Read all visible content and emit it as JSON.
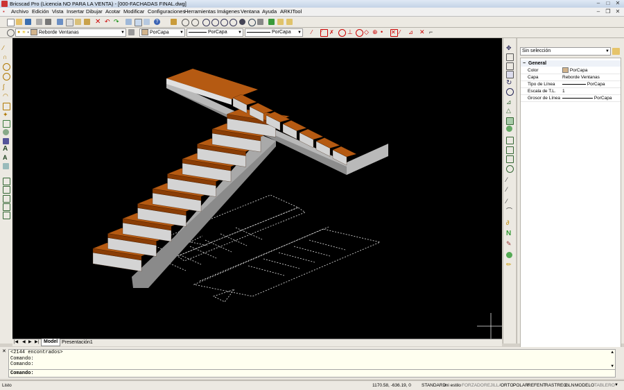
{
  "window": {
    "title": "Bricscad Pro (Licencia NO PARA LA VENTA) - [000-FACHADAS FINAL.dwg]"
  },
  "menu": [
    "Archivo",
    "Edición",
    "Vista",
    "Insertar",
    "Dibujar",
    "Acotar",
    "Modificar",
    "Configuraciones",
    "Herramientas",
    "Imágenes",
    "Ventana",
    "Ayuda",
    "ARKITool"
  ],
  "layer_toolbar": {
    "layer_value": "Reborde Ventanas",
    "color_value": "PorCapa",
    "linetype_value": "PorCapa",
    "lineweight_value": "PorCapa"
  },
  "properties": {
    "selection": "Sin selección",
    "section": "General",
    "rows": [
      {
        "label": "Color",
        "value": "PorCapa"
      },
      {
        "label": "Capa",
        "value": "Reborde Ventanas"
      },
      {
        "label": "Tipo de Línea",
        "value": "PorCapa"
      },
      {
        "label": "Escala de T.L.",
        "value": "1"
      },
      {
        "label": "Grosor de Línea",
        "value": "PorCapa"
      }
    ]
  },
  "tabs": {
    "model": "Model",
    "layout": "Presentación1"
  },
  "command": {
    "history": [
      "<2144 encontrados>",
      "Comando:",
      "Comando:"
    ],
    "prompt": "Comando:"
  },
  "status": {
    "ready": "Listo",
    "coords": "1170.58, -636.19, 0",
    "style_std": "STANDARD",
    "style_mine": "mi estilo",
    "toggles": [
      "FORZADO",
      "REJILLA",
      "ORTO",
      "POLAR",
      "REFENT",
      "RASTREO",
      "GLN",
      "MODELO",
      "TABLERO"
    ]
  },
  "colors": {
    "tread": "#b55a12",
    "riser": "#d4d4d4",
    "side": "#a9a9a9",
    "cmd_bg": "#fffff0"
  }
}
